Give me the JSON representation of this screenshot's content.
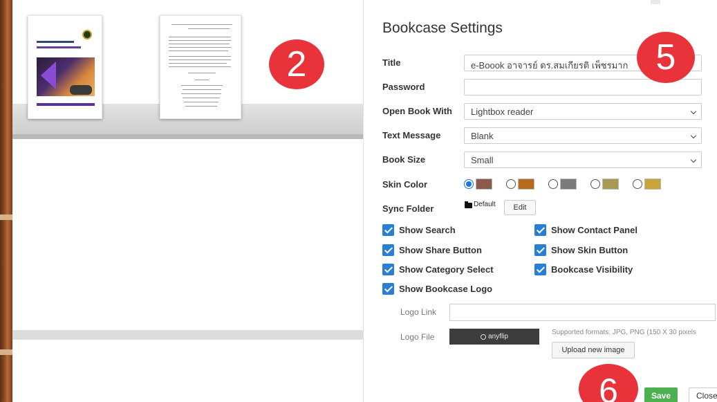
{
  "dialog": {
    "title": "Bookcase Settings",
    "corner_icon": "menu-handle-icon"
  },
  "markers": {
    "m2": "2",
    "m5": "5",
    "m6": "6"
  },
  "preview": {
    "book1_icon": "ebook-cover-icon",
    "book2_icon": "document-page-icon"
  },
  "form": {
    "title_label": "Title",
    "title_value": "e-Boook อาจารย์ ดร.สมเกียรติ เพ็ชรมาก",
    "password_label": "Password",
    "password_value": "",
    "open_book_label": "Open Book With",
    "open_book_value": "Lightbox reader",
    "text_message_label": "Text Message",
    "text_message_value": "Blank",
    "book_size_label": "Book Size",
    "book_size_value": "Small",
    "skin_color_label": "Skin Color",
    "skin_colors": [
      "#8b5a4a",
      "#b86a1c",
      "#7a7a7a",
      "#a89a52",
      "#c8a43a"
    ],
    "skin_selected_index": 0,
    "sync_folder_label": "Sync Folder",
    "sync_folder_value": "Default",
    "edit_label": "Edit"
  },
  "checkboxes": {
    "show_search": "Show Search",
    "show_contact_panel": "Show Contact Panel",
    "show_share_button": "Show Share Button",
    "show_skin_button": "Show Skin Button",
    "show_category_select": "Show Category Select",
    "bookcase_visibility": "Bookcase Visibility",
    "show_bookcase_logo": "Show Bookcase Logo"
  },
  "logo": {
    "link_label": "Logo Link",
    "link_value": "",
    "file_label": "Logo File",
    "preview_text": "anyflip",
    "supported_text": "Supported formats: JPG, PNG (150 X 30 pixels",
    "upload_label": "Upload new image"
  },
  "footer": {
    "save_label": "Save",
    "close_label": "Close"
  }
}
